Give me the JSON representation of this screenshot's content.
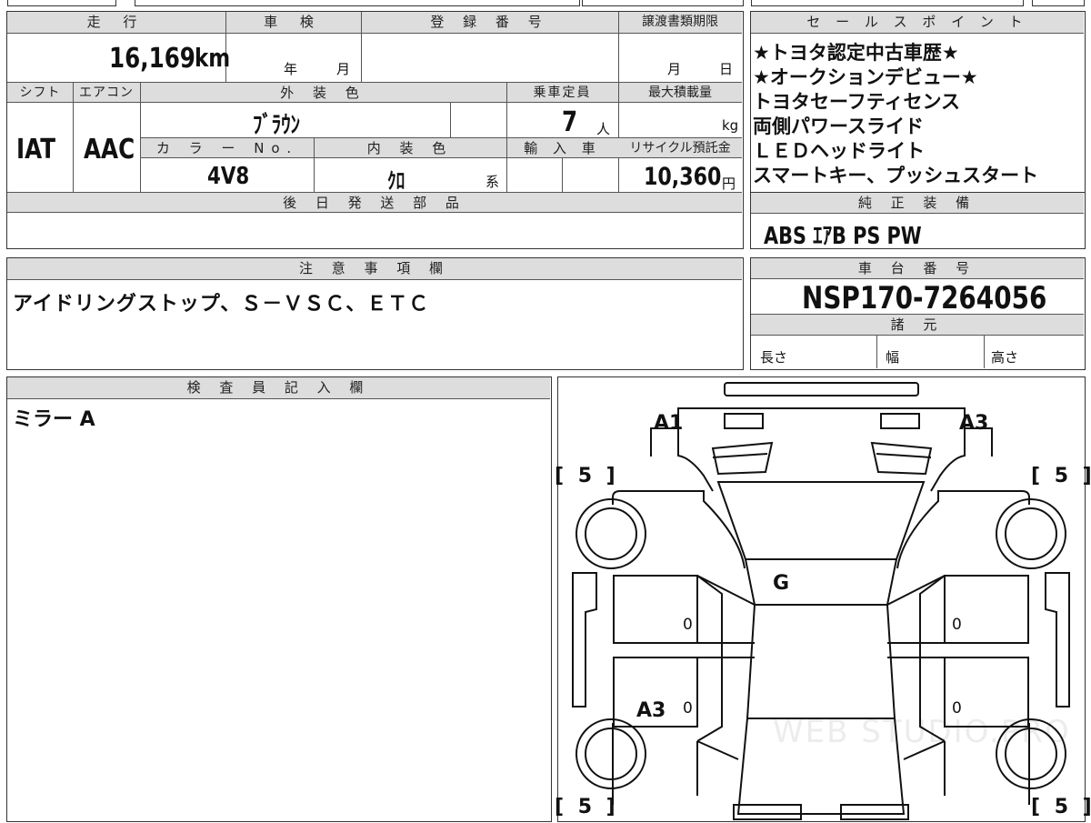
{
  "vehicle": {
    "mileage_header": "走 行",
    "mileage_value": "16,169",
    "mileage_unit": "km",
    "inspection_header": "車 検",
    "inspection_year": "年",
    "inspection_month": "月",
    "registration_header": "登 録 番 号",
    "transfer_doc_header": "譲渡書類期限",
    "transfer_month": "月",
    "transfer_day": "日",
    "shift_header": "シフト",
    "shift_value": "IAT",
    "ac_header": "エアコン",
    "ac_value": "AAC",
    "exterior_color_header": "外 装 色",
    "exterior_color_value": "ﾌﾞﾗｳﾝ",
    "capacity_header": "乗車定員",
    "capacity_value": "7",
    "capacity_unit": "人",
    "max_load_header": "最大積載量",
    "max_load_unit": "kg",
    "color_no_header": "カ ラ ー No.",
    "color_no_value": "4V8",
    "interior_color_header": "内 装 色",
    "interior_color_value": "ｸﾛ",
    "interior_color_suffix": "系",
    "import_header": "輸 入 車",
    "recycle_header": "リサイクル預託金",
    "recycle_value": "10,360",
    "recycle_unit": "円",
    "later_parts_header": "後 日 発 送 部 品"
  },
  "sales_points": {
    "header": "セ ー ル ス ポ イ ン ト",
    "items": [
      "★トヨタ認定中古車歴★",
      "★オークションデビュー★",
      "トヨタセーフティセンス",
      "両側パワースライド",
      "ＬＥＤヘッドライト",
      "スマートキー、プッシュスタート"
    ]
  },
  "equipment": {
    "header": "純 正 装 備",
    "value": "ABS ｴｱB PS PW"
  },
  "notes": {
    "header": "注 意 事 項 欄",
    "value": "アイドリングストップ、Ｓ－ＶＳＣ、ＥＴＣ"
  },
  "chassis": {
    "header": "車 台 番 号",
    "value": "NSP170-7264056"
  },
  "specs": {
    "header": "諸 元",
    "length_label": "長さ",
    "width_label": "幅",
    "height_label": "高さ"
  },
  "inspector": {
    "header": "検 査 員 記 入 欄",
    "value": "ミラー A"
  },
  "diagram": {
    "tires": [
      "[ 5 ]",
      "[ 5 ]",
      "[ 5 ]",
      "[ 5 ]"
    ],
    "mark_a1": "A1",
    "mark_a3_right": "A3",
    "mark_g": "G",
    "mark_a3_left": "A3",
    "seat_marks": [
      "0",
      "0",
      "0",
      "0"
    ],
    "watermark": "WEB STUDIO.PRO"
  }
}
